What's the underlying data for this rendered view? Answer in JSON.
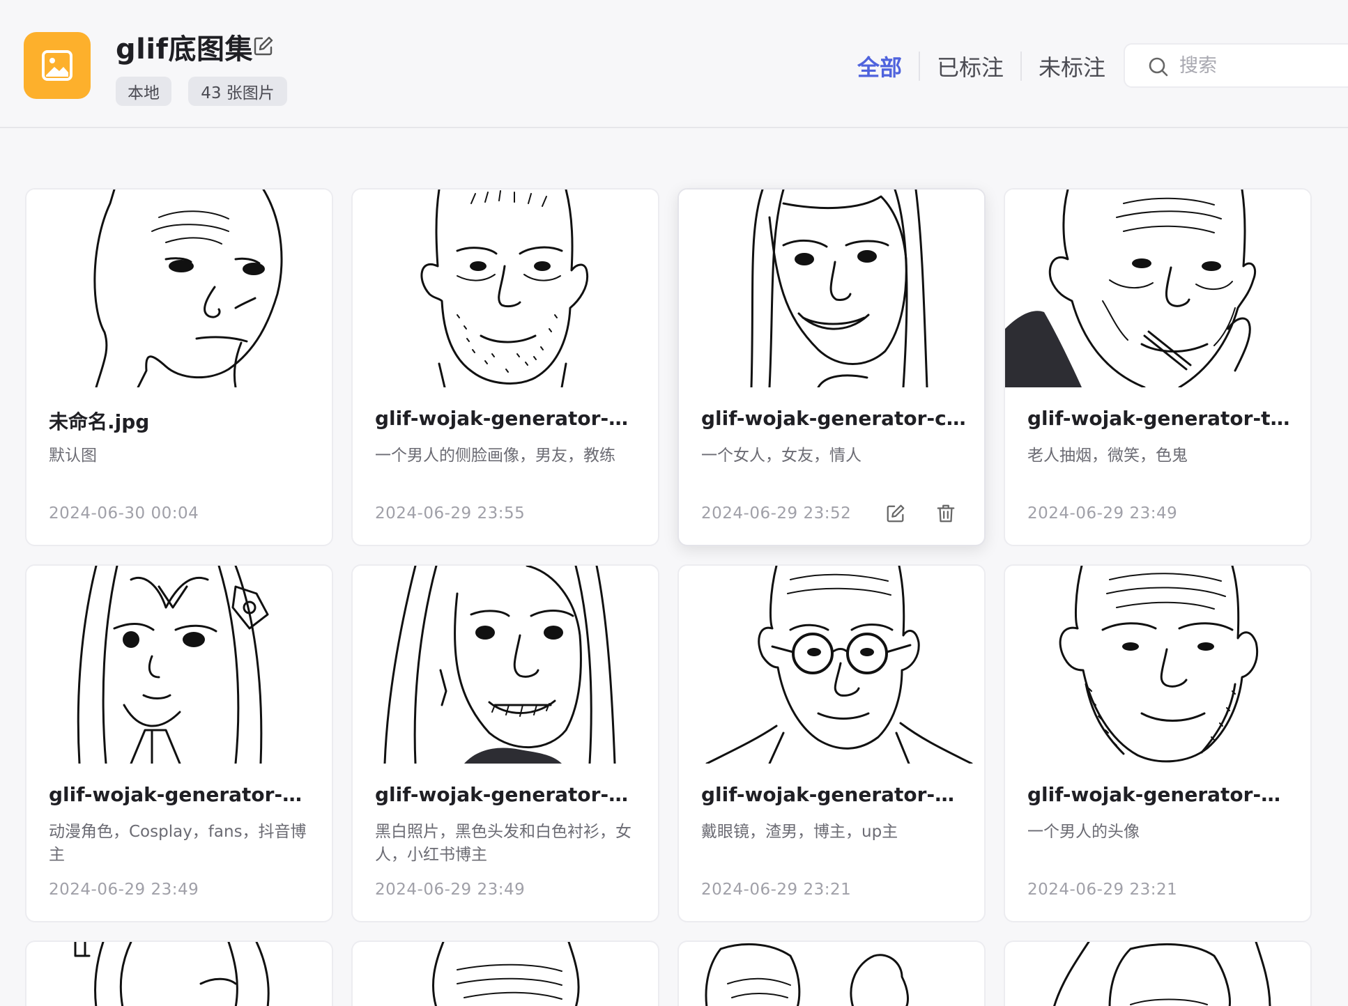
{
  "header": {
    "title": "glif底图集",
    "tags": {
      "local": "本地",
      "count": "43 张图片"
    }
  },
  "filters": {
    "all": "全部",
    "labeled": "已标注",
    "unlabeled": "未标注",
    "active": "all"
  },
  "search": {
    "placeholder": "搜索",
    "value": ""
  },
  "colors": {
    "accent": "#4f63dd",
    "app_icon": "#fdb02c"
  },
  "cards": [
    {
      "title": "未命名.jpg",
      "desc": "默认图",
      "date": "2024-06-30 00:04"
    },
    {
      "title": "glif-wojak-generator-mar...",
      "desc": "一个男人的侧脸画像，男友，教练",
      "date": "2024-06-29 23:55"
    },
    {
      "title": "glif-wojak-generator-ck-...",
      "desc": "一个女人，女友，情人",
      "date": "2024-06-29 23:52"
    },
    {
      "title": "glif-wojak-generator-tow...",
      "desc": "老人抽烟，微笑，色鬼",
      "date": "2024-06-29 23:49"
    },
    {
      "title": "glif-wojak-generator-dar...",
      "desc": "动漫角色，Cosplay，fans，抖音博主",
      "date": "2024-06-29 23:49"
    },
    {
      "title": "glif-wojak-generator-nico...",
      "desc": "黑白照片，黑色头发和白色衬衫，女人，小红书博主",
      "date": "2024-06-29 23:49"
    },
    {
      "title": "glif-wojak-generator-mar...",
      "desc": "戴眼镜，渣男，博主，up主",
      "date": "2024-06-29 23:21"
    },
    {
      "title": "glif-wojak-generator-delo...",
      "desc": "一个男人的头像",
      "date": "2024-06-29 23:21"
    }
  ]
}
